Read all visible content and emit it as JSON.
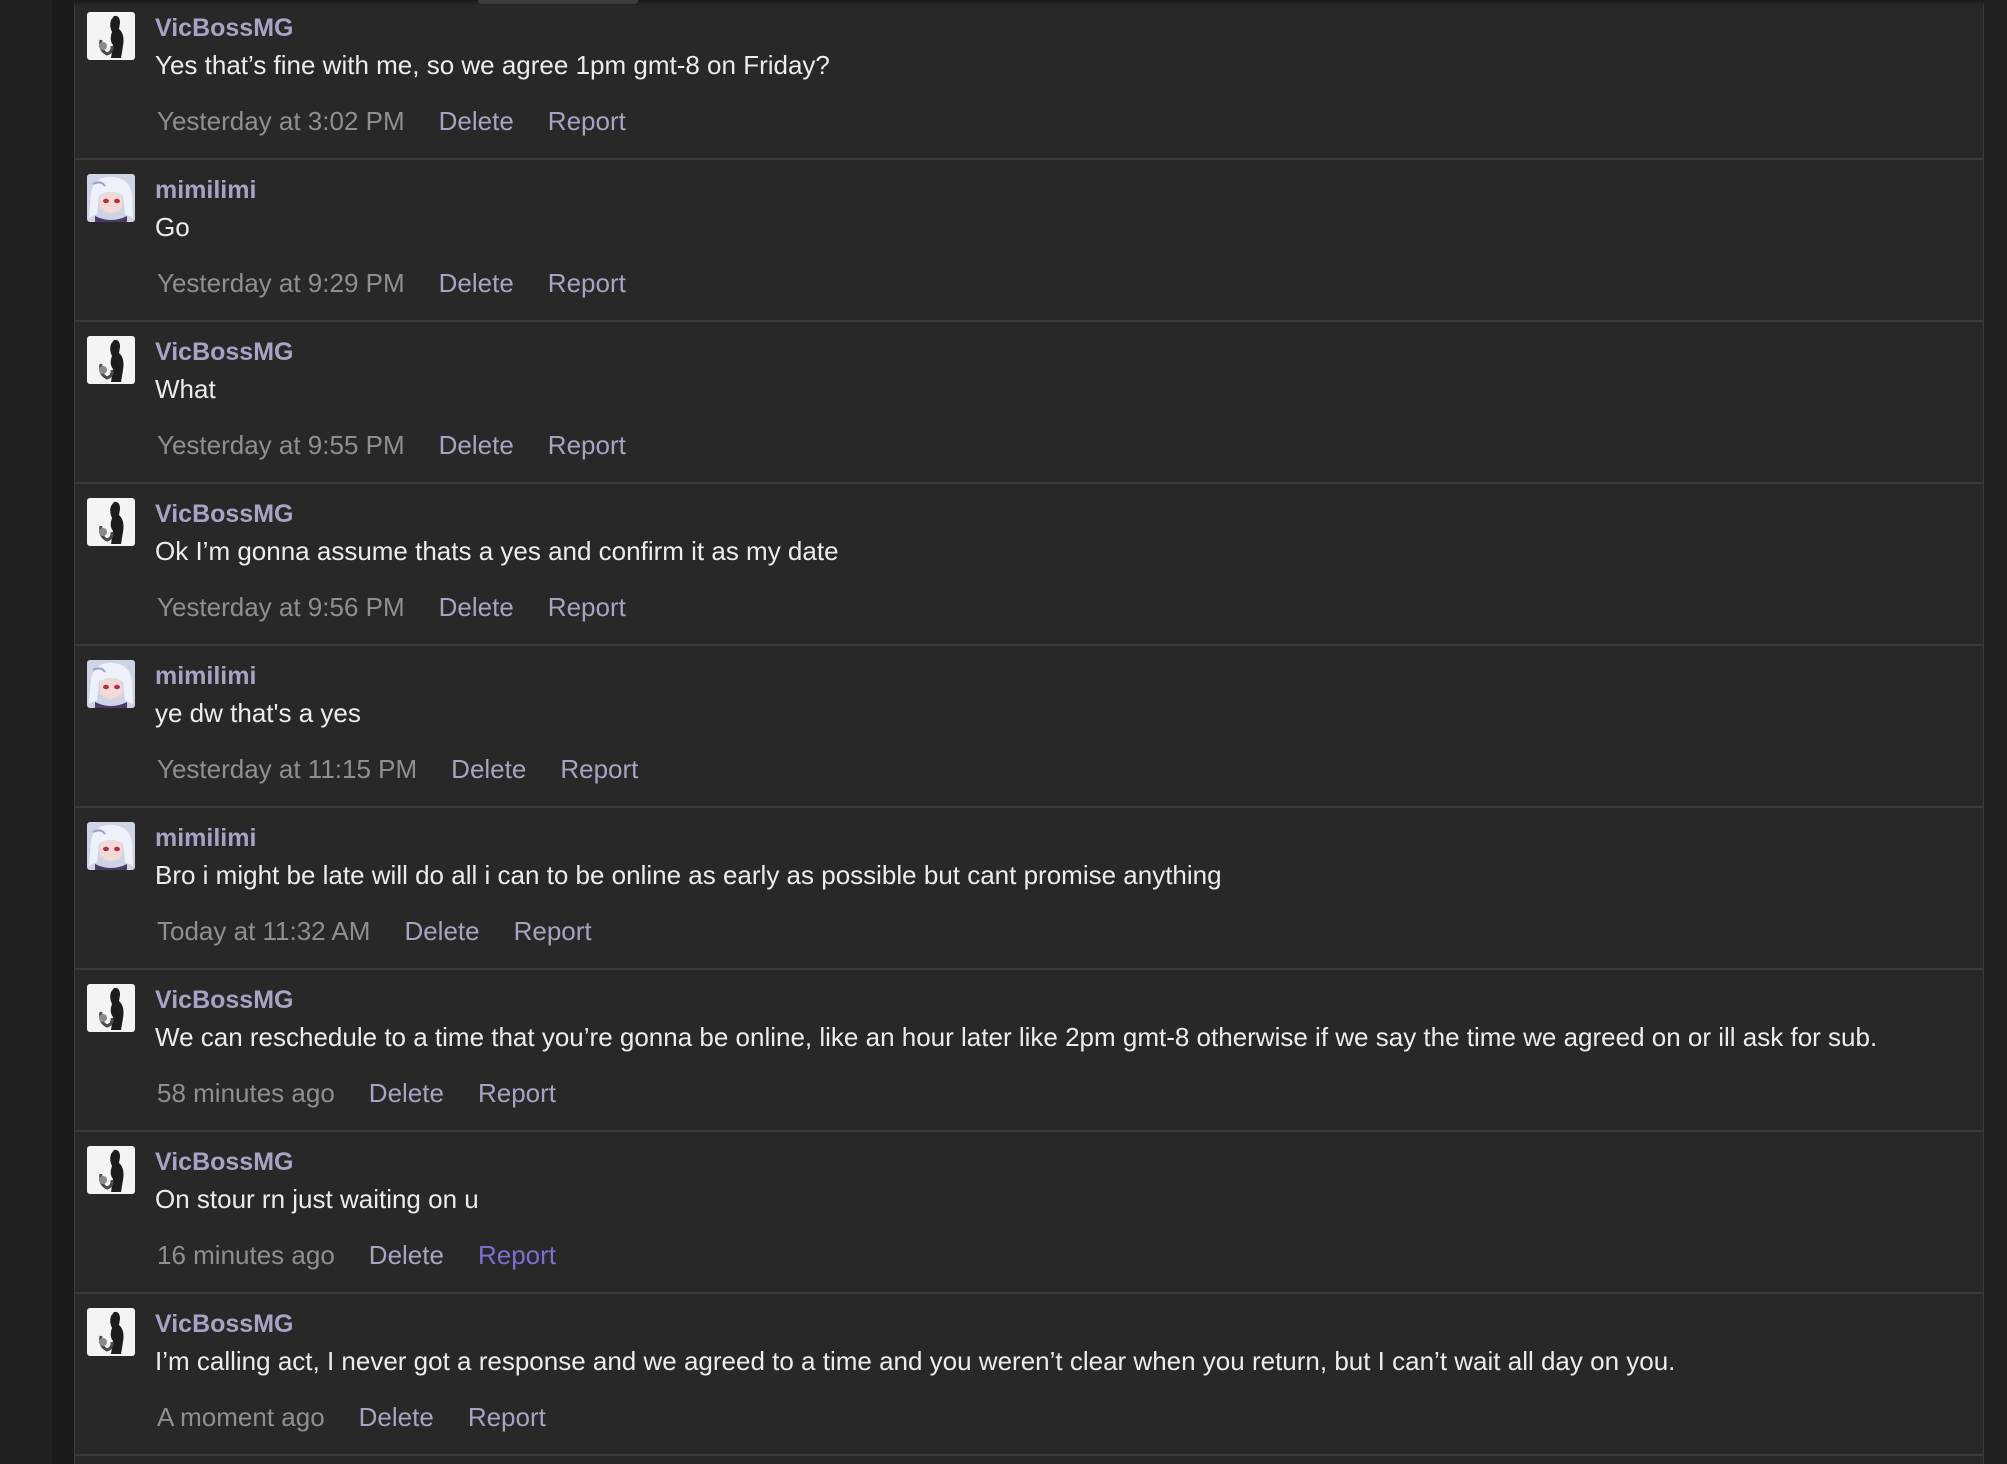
{
  "messages": [
    {
      "author": "VicBossMG",
      "avatar": "vicbossmg-avatar",
      "text": "Yes that’s fine with me, so we agree 1pm gmt-8 on Friday?",
      "time": "Yesterday at 3:02 PM",
      "delete_label": "Delete",
      "report_label": "Report"
    },
    {
      "author": "mimilimi",
      "avatar": "mimilimi-avatar",
      "text": "Go",
      "time": "Yesterday at 9:29 PM",
      "delete_label": "Delete",
      "report_label": "Report"
    },
    {
      "author": "VicBossMG",
      "avatar": "vicbossmg-avatar",
      "text": "What",
      "time": "Yesterday at 9:55 PM",
      "delete_label": "Delete",
      "report_label": "Report"
    },
    {
      "author": "VicBossMG",
      "avatar": "vicbossmg-avatar",
      "text": "Ok I’m gonna assume thats a yes and confirm it as my date",
      "time": "Yesterday at 9:56 PM",
      "delete_label": "Delete",
      "report_label": "Report"
    },
    {
      "author": "mimilimi",
      "avatar": "mimilimi-avatar",
      "text": "ye dw that's a yes",
      "time": "Yesterday at 11:15 PM",
      "delete_label": "Delete",
      "report_label": "Report"
    },
    {
      "author": "mimilimi",
      "avatar": "mimilimi-avatar",
      "text": "Bro i might be late will do all i can to be online as early as possible but cant promise anything",
      "time": "Today at 11:32 AM",
      "delete_label": "Delete",
      "report_label": "Report"
    },
    {
      "author": "VicBossMG",
      "avatar": "vicbossmg-avatar",
      "text": "We can reschedule to a time that you’re gonna be online, like an hour later like 2pm gmt-8 otherwise if we say the time we agreed on or ill ask for sub.",
      "time": "58 minutes ago",
      "delete_label": "Delete",
      "report_label": "Report"
    },
    {
      "author": "VicBossMG",
      "avatar": "vicbossmg-avatar",
      "text": "On stour rn just waiting on u",
      "time": "16 minutes ago",
      "delete_label": "Delete",
      "report_label": "Report"
    },
    {
      "author": "VicBossMG",
      "avatar": "vicbossmg-avatar",
      "text": "I’m calling act, I never got a response and we agreed to a time and you weren’t clear when you return, but I can’t wait all day on you.",
      "time": "A moment ago",
      "delete_label": "Delete",
      "report_label": "Report"
    }
  ],
  "colors": {
    "background": "#222222",
    "panel": "#282828",
    "divider": "#3a3a3a",
    "author": "#a8a2c4",
    "text": "#ececec",
    "timestamp": "#8f8f8f",
    "action": "#a7a3c0",
    "action_hover": "#7d6fd2"
  }
}
